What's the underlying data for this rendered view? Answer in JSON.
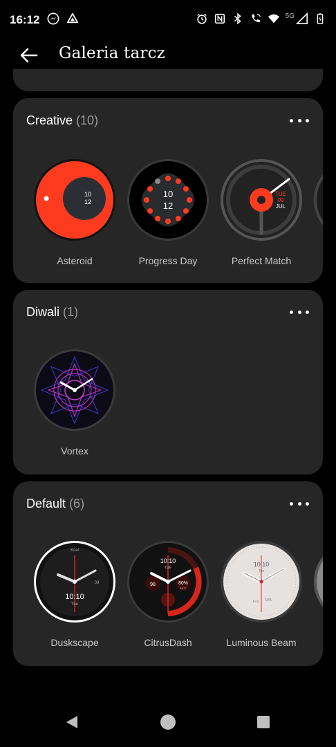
{
  "status": {
    "time": "16:12",
    "network": "5G"
  },
  "app_bar": {
    "title": "Galeria tarcz"
  },
  "categories": [
    {
      "name": "Creative",
      "count": "(10)",
      "faces": [
        {
          "label": "Asteroid",
          "text1": "10",
          "text2": "12"
        },
        {
          "label": "Progress Day",
          "text1": "10",
          "text2": "12"
        },
        {
          "label": "Perfect Match",
          "text1": "TUE",
          "text2": "09",
          "text3": "JUL"
        }
      ]
    },
    {
      "name": "Diwali",
      "count": "(1)",
      "faces": [
        {
          "label": "Vortex"
        }
      ]
    },
    {
      "name": "Default",
      "count": "(6)",
      "faces": [
        {
          "label": "Duskscape",
          "time": "10:10",
          "day": "Tue",
          "kcal": "Kcal",
          "date": "09"
        },
        {
          "label": "CitrusDash",
          "time": "10:10",
          "day": "TUE",
          "heart": "98",
          "batt": "80%",
          "batt_label": "BATT"
        },
        {
          "label": "Luminous Beam",
          "time": "10:10",
          "day": "Tue",
          "kcal": "Kca",
          "batt": "50%"
        }
      ]
    }
  ],
  "colors": {
    "background": "#000000",
    "card": "#262626",
    "accent_red": "#ff3b1f",
    "label_text": "#c9c9c9"
  }
}
